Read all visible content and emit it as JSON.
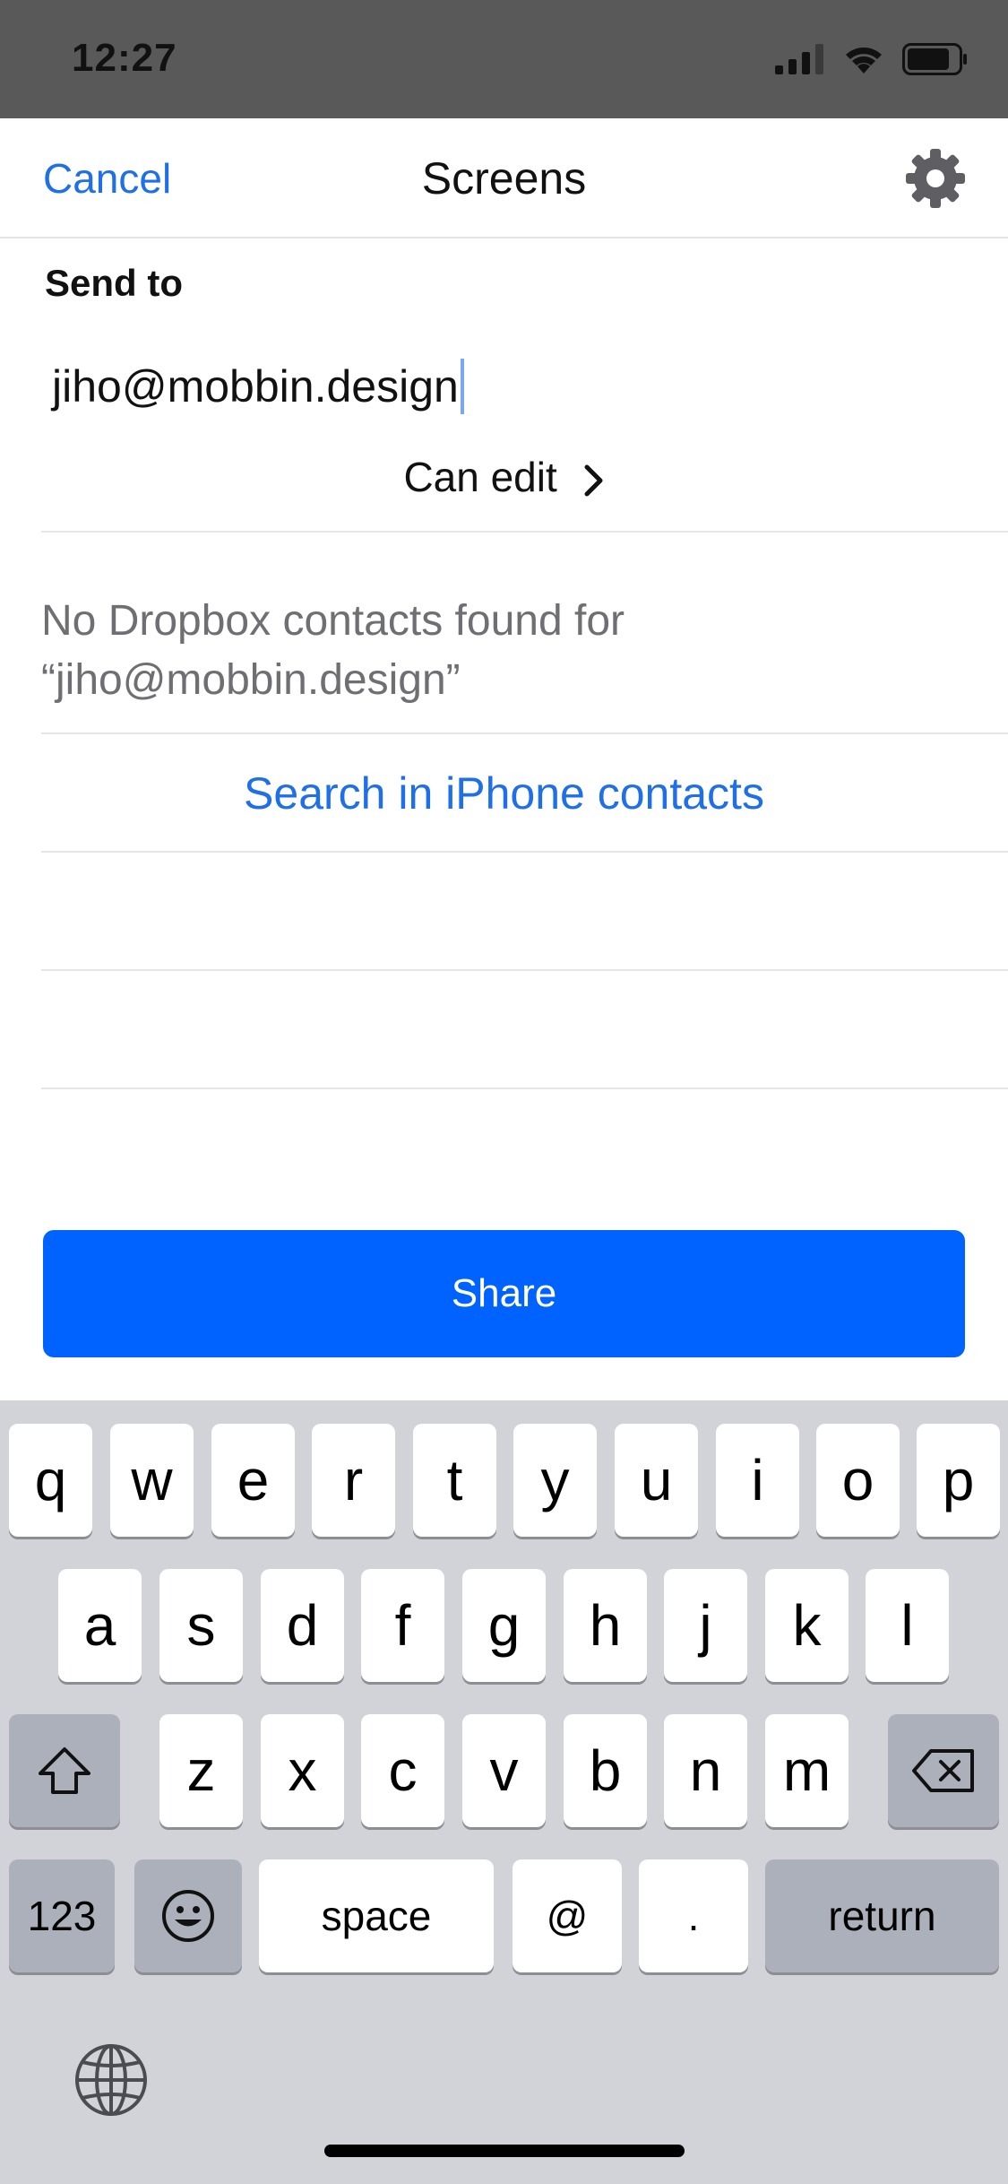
{
  "status_bar": {
    "time": "12:27"
  },
  "nav": {
    "cancel_label": "Cancel",
    "title": "Screens",
    "settings_icon": "gear-icon"
  },
  "form": {
    "send_to_label": "Send to",
    "recipient_value": "jiho@mobbin.design",
    "permission_label": "Can edit"
  },
  "results": {
    "no_contacts_line1": "No Dropbox contacts found for",
    "no_contacts_line2": "“jiho@mobbin.design”",
    "search_link": "Search in iPhone contacts"
  },
  "share_label": "Share",
  "keyboard": {
    "row1": [
      "q",
      "w",
      "e",
      "r",
      "t",
      "y",
      "u",
      "i",
      "o",
      "p"
    ],
    "row2": [
      "a",
      "s",
      "d",
      "f",
      "g",
      "h",
      "j",
      "k",
      "l"
    ],
    "row3": [
      "z",
      "x",
      "c",
      "v",
      "b",
      "n",
      "m"
    ],
    "numbers_label": "123",
    "space_label": "space",
    "at_label": "@",
    "dot_label": ".",
    "return_label": "return"
  },
  "colors": {
    "accent": "#1f6fe8",
    "share_button": "#0062ff",
    "status_bar": "#595959",
    "keyboard_bg": "#d1d3d9"
  }
}
